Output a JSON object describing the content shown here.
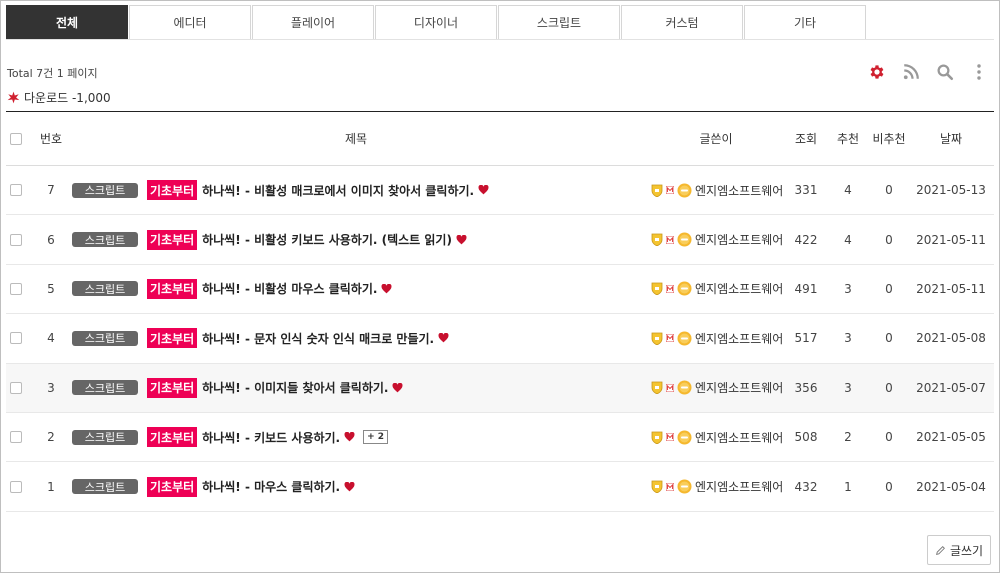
{
  "tabs": [
    {
      "label": "전체",
      "active": true
    },
    {
      "label": "에디터"
    },
    {
      "label": "플레이어"
    },
    {
      "label": "디자이너"
    },
    {
      "label": "스크립트"
    },
    {
      "label": "커스텀"
    },
    {
      "label": "기타"
    }
  ],
  "info": {
    "total": "Total 7건 1 페이지",
    "download": "다운로드 -1,000"
  },
  "header": {
    "no": "번호",
    "title": "제목",
    "author": "글쓴이",
    "views": "조회",
    "likes": "추천",
    "dislikes": "비추천",
    "date": "날짜"
  },
  "rows": [
    {
      "no": "7",
      "category": "스크립트",
      "tag": "기초부터",
      "title": "하나씩! - 비활성 매크로에서 이미지 찾아서 클릭하기.",
      "comments": "",
      "author": "엔지엠소프트웨어",
      "views": "331",
      "likes": "4",
      "dislikes": "0",
      "date": "2021-05-13"
    },
    {
      "no": "6",
      "category": "스크립트",
      "tag": "기초부터",
      "title": "하나씩! - 비활성 키보드 사용하기. (텍스트 읽기)",
      "comments": "",
      "author": "엔지엠소프트웨어",
      "views": "422",
      "likes": "4",
      "dislikes": "0",
      "date": "2021-05-11"
    },
    {
      "no": "5",
      "category": "스크립트",
      "tag": "기초부터",
      "title": "하나씩! - 비활성 마우스 클릭하기.",
      "comments": "",
      "author": "엔지엠소프트웨어",
      "views": "491",
      "likes": "3",
      "dislikes": "0",
      "date": "2021-05-11"
    },
    {
      "no": "4",
      "category": "스크립트",
      "tag": "기초부터",
      "title": "하나씩! - 문자 인식 숫자 인식 매크로 만들기.",
      "comments": "",
      "author": "엔지엠소프트웨어",
      "views": "517",
      "likes": "3",
      "dislikes": "0",
      "date": "2021-05-08"
    },
    {
      "no": "3",
      "category": "스크립트",
      "tag": "기초부터",
      "title": "하나씩! - 이미지들 찾아서 클릭하기.",
      "comments": "",
      "author": "엔지엠소프트웨어",
      "views": "356",
      "likes": "3",
      "dislikes": "0",
      "date": "2021-05-07",
      "shaded": true
    },
    {
      "no": "2",
      "category": "스크립트",
      "tag": "기초부터",
      "title": "하나씩! - 키보드 사용하기.",
      "comments": "+ 2",
      "author": "엔지엠소프트웨어",
      "views": "508",
      "likes": "2",
      "dislikes": "0",
      "date": "2021-05-05"
    },
    {
      "no": "1",
      "category": "스크립트",
      "tag": "기초부터",
      "title": "하나씩! - 마우스 클릭하기.",
      "comments": "",
      "author": "엔지엠소프트웨어",
      "views": "432",
      "likes": "1",
      "dislikes": "0",
      "date": "2021-05-04"
    }
  ],
  "write_label": "글쓰기",
  "colors": {
    "accent_tag": "#ee0055",
    "settings_icon": "#d0202f",
    "tool_icon": "#999999",
    "heart": "#c8102e",
    "active_tab": "#333333"
  },
  "icons": {
    "settings": "gear-icon",
    "rss": "rss-icon",
    "search": "search-icon",
    "more": "more-vertical-icon",
    "download": "star-burst-icon",
    "heart": "heart-icon",
    "write": "pencil-icon"
  }
}
